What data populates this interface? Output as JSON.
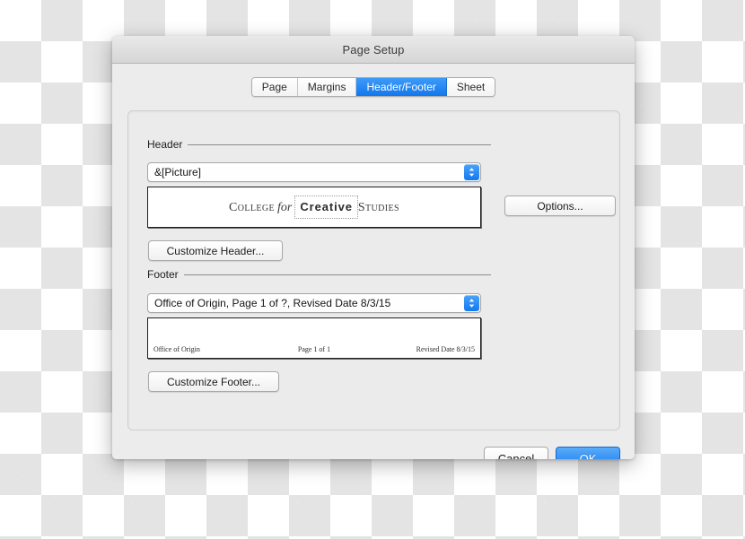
{
  "window": {
    "title": "Page Setup"
  },
  "tabs": [
    {
      "label": "Page",
      "active": false
    },
    {
      "label": "Margins",
      "active": false
    },
    {
      "label": "Header/Footer",
      "active": true
    },
    {
      "label": "Sheet",
      "active": false
    }
  ],
  "header_section": {
    "label": "Header",
    "combo_value": "&[Picture]",
    "combo_arrow_icon": "up-down-chevron-icon",
    "preview": {
      "logo_word1": "College",
      "logo_word2": "for",
      "logo_word3": "Creative",
      "logo_word4": "Studies"
    },
    "customize_button": "Customize Header...",
    "options_button": "Options..."
  },
  "footer_section": {
    "label": "Footer",
    "combo_value": "Office of Origin, Page 1 of ?, Revised  Date 8/3/15",
    "combo_arrow_icon": "up-down-chevron-icon",
    "preview": {
      "left": "Office of Origin",
      "center": "Page 1 of 1",
      "right": "Revised  Date 8/3/15"
    },
    "customize_button": "Customize Footer..."
  },
  "actions": {
    "cancel_label": "Cancel",
    "ok_label": "OK"
  },
  "colors": {
    "accent_blue": "#1479ef",
    "tab_active_blue": "#1277ee",
    "dialog_bg": "#ececec",
    "panel_bg": "#ebebeb"
  }
}
